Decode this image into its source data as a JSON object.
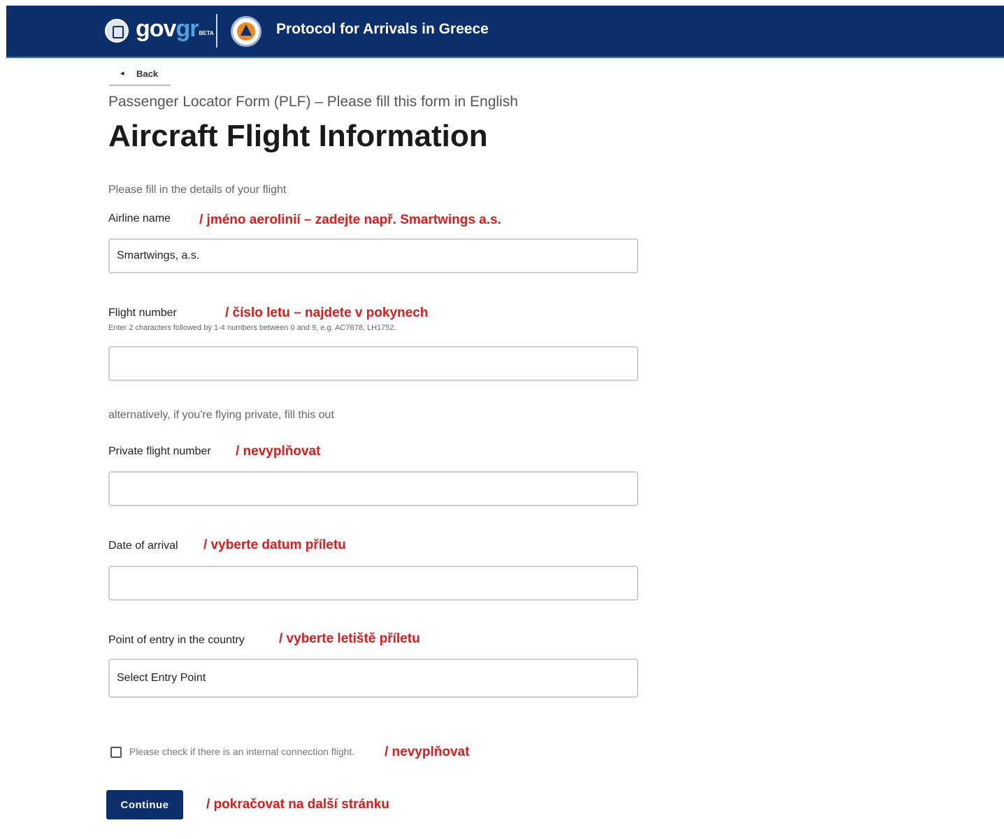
{
  "header": {
    "logo_text_gov": "gov",
    "logo_text_gr": "gr",
    "logo_beta": "BETA",
    "title": "Protocol for Arrivals in Greece"
  },
  "nav": {
    "back_label": "Back"
  },
  "page": {
    "subtitle": "Passenger Locator Form (PLF) – Please fill this form in English",
    "title": "Aircraft Flight Information",
    "intro": "Please fill in the details of your flight",
    "alt_text": "alternatively, if you're flying private, fill this out"
  },
  "fields": {
    "airline": {
      "label": "Airline name",
      "value": "Smartwings, a.s.",
      "note": "/ jméno aerolinií – zadejte např. Smartwings a.s."
    },
    "flight_number": {
      "label": "Flight number",
      "hint": "Enter 2 characters followed by 1-4 numbers between 0 and 9, e.g. AC7678, LH1752.",
      "value": "",
      "note": "/ číslo letu – najdete v pokynech"
    },
    "private_flight": {
      "label": "Private flight number",
      "value": "",
      "note": "/ nevyplňovat"
    },
    "arrival_date": {
      "label": "Date of arrival",
      "value": "",
      "note": "/ vyberte datum příletu"
    },
    "entry_point": {
      "label": "Point of entry in the country",
      "selected": "Select Entry Point",
      "note": "/ vyberte letiště příletu"
    },
    "connection": {
      "label": "Please check if there is an internal connection flight.",
      "checked": false,
      "note": "/ nevyplňovat"
    }
  },
  "actions": {
    "continue_label": "Continue",
    "continue_note": "/ pokračovat na další stránku"
  },
  "colors": {
    "header_bg": "#0b2f6b",
    "annotation": "#e01919",
    "button_bg": "#0b2f6b"
  }
}
